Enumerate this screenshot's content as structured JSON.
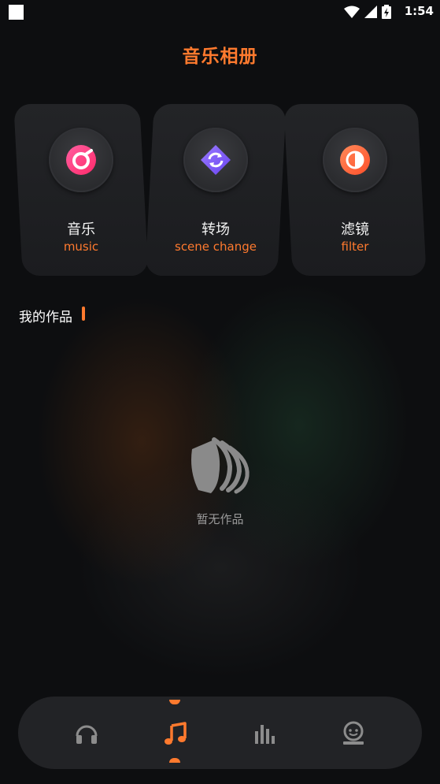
{
  "status_bar": {
    "time": "1:54"
  },
  "header": {
    "title": "音乐相册"
  },
  "features": [
    {
      "title": "音乐",
      "subtitle": "music",
      "icon": "music-disc-icon",
      "color": "#ff3d7f"
    },
    {
      "title": "转场",
      "subtitle": "scene change",
      "icon": "transition-icon",
      "color": "#7b5cff"
    },
    {
      "title": "滤镜",
      "subtitle": "filter",
      "icon": "filter-icon",
      "color": "#ff6a3d"
    }
  ],
  "works": {
    "section_title": "我的作品",
    "empty_text": "暂无作品"
  },
  "bottom_nav": {
    "items": [
      {
        "icon": "headphones-icon",
        "active": false
      },
      {
        "icon": "music-note-icon",
        "active": true
      },
      {
        "icon": "equalizer-icon",
        "active": false
      },
      {
        "icon": "profile-icon",
        "active": false
      }
    ]
  },
  "colors": {
    "accent": "#ff7a2e",
    "background": "#0d0e10",
    "card": "#222326"
  }
}
